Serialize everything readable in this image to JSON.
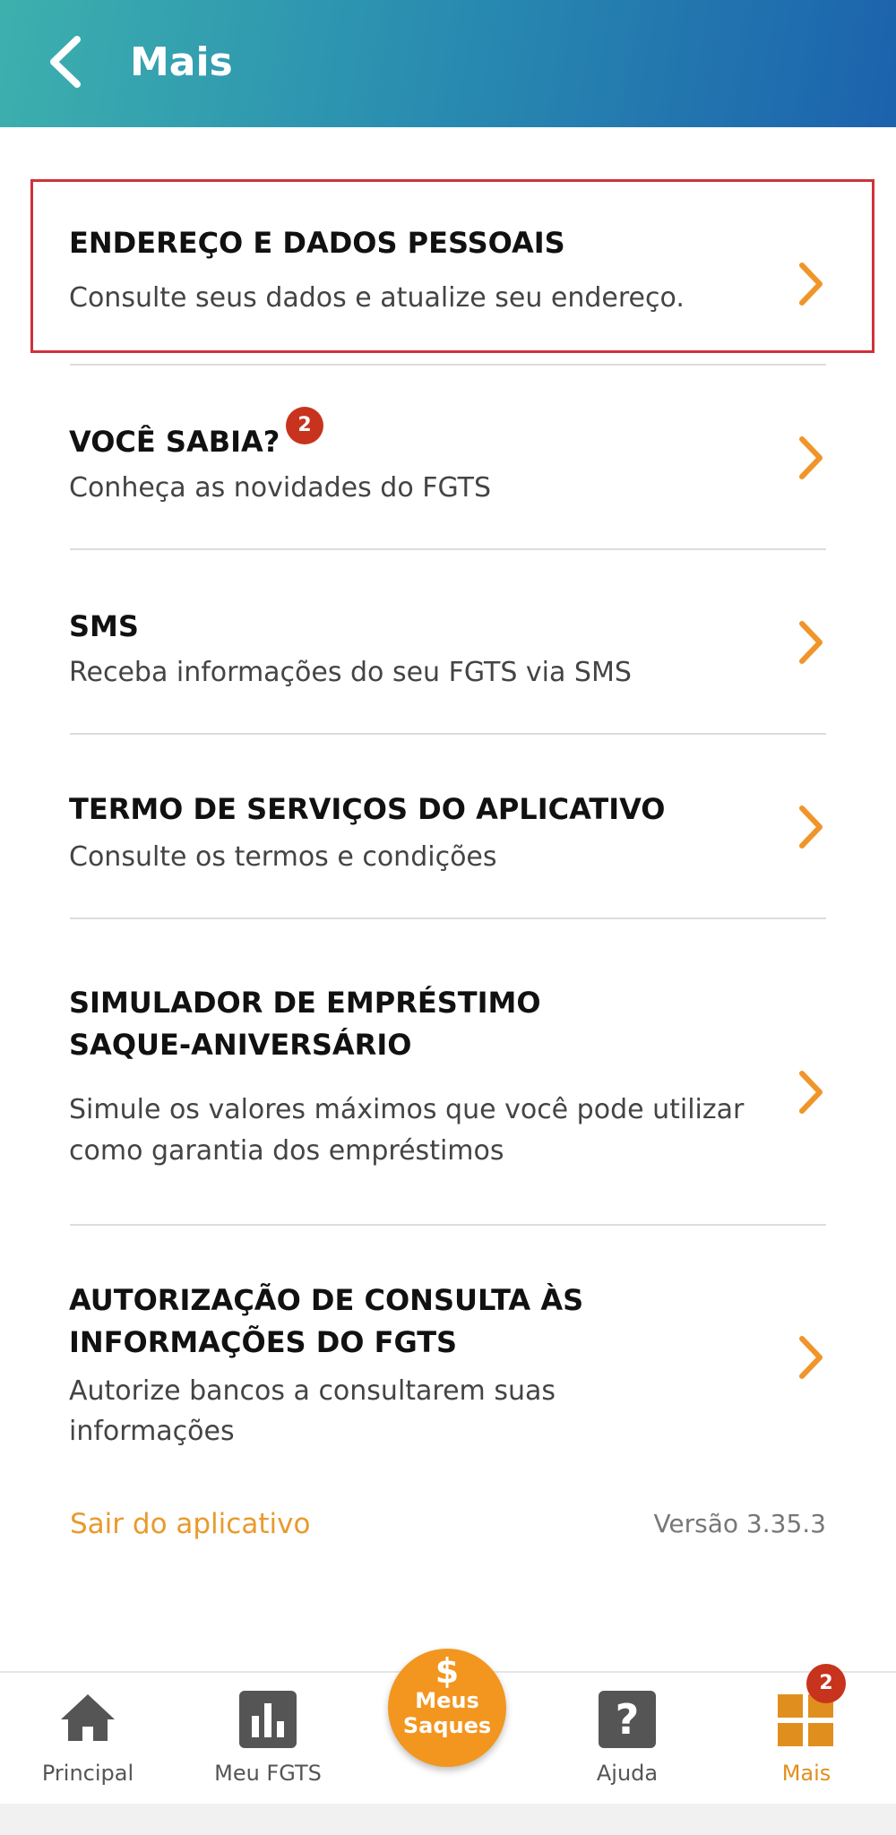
{
  "header": {
    "title": "Mais",
    "back_icon": "chevron-left-icon"
  },
  "menu": {
    "items": [
      {
        "title": "ENDEREÇO E DADOS PESSOAIS",
        "subtitle": "Consulte seus dados e atualize seu endereço."
      },
      {
        "title": "VOCÊ SABIA?",
        "badge": "2",
        "subtitle": "Conheça as novidades do FGTS"
      },
      {
        "title": "SMS",
        "subtitle": "Receba informações do seu FGTS via SMS"
      },
      {
        "title": "TERMO DE SERVIÇOS DO APLICATIVO",
        "subtitle": "Consulte os termos e condições"
      },
      {
        "title_line1": "SIMULADOR DE EMPRÉSTIMO",
        "title_line2": "SAQUE-ANIVERSÁRIO",
        "subtitle_line1": "Simule os valores máximos que você pode utilizar",
        "subtitle_line2": "como garantia dos empréstimos"
      },
      {
        "title_line1": "AUTORIZAÇÃO DE CONSULTA ÀS",
        "title_line2": "INFORMAÇÕES DO FGTS",
        "subtitle_line1": "Autorize bancos a consultarem suas",
        "subtitle_line2": "informações"
      }
    ]
  },
  "footer": {
    "logout": "Sair do aplicativo",
    "version": "Versão 3.35.3"
  },
  "bottom_nav": {
    "principal": "Principal",
    "meu_fgts": "Meu FGTS",
    "saques_symbol": "$",
    "saques_line1": "Meus",
    "saques_line2": "Saques",
    "ajuda": "Ajuda",
    "ajuda_symbol": "?",
    "mais": "Mais",
    "mais_badge": "2"
  },
  "colors": {
    "accent": "#f3961f",
    "chevron": "#f0952a",
    "badge": "#c8331e",
    "highlight_border": "#d0313b",
    "header_start": "#3db0ae",
    "header_end": "#1c62ad"
  }
}
